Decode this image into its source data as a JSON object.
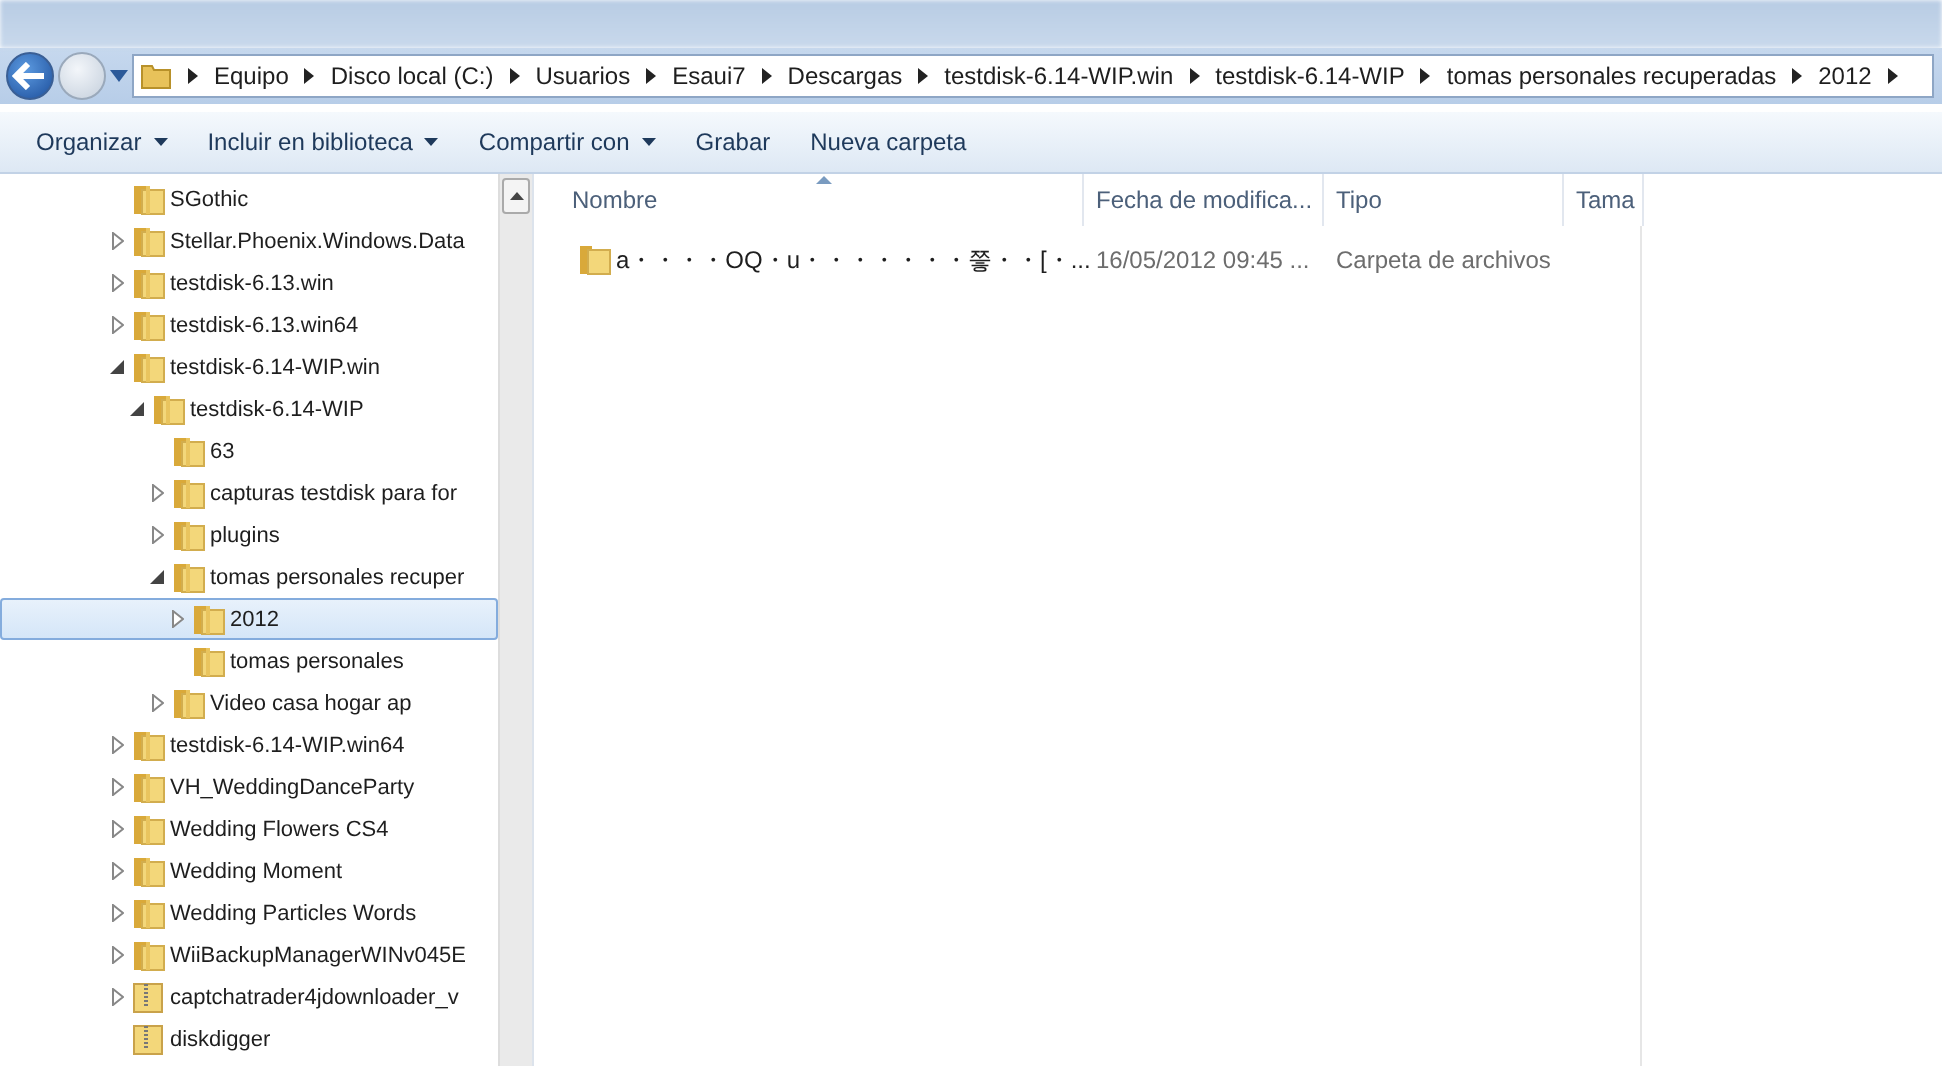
{
  "breadcrumb": [
    "Equipo",
    "Disco local (C:)",
    "Usuarios",
    "Esaui7",
    "Descargas",
    "testdisk-6.14-WIP.win",
    "testdisk-6.14-WIP",
    "tomas personales recuperadas",
    "2012"
  ],
  "toolbar": [
    {
      "label": "Organizar",
      "dropdown": true
    },
    {
      "label": "Incluir en biblioteca",
      "dropdown": true
    },
    {
      "label": "Compartir con",
      "dropdown": true
    },
    {
      "label": "Grabar",
      "dropdown": false
    },
    {
      "label": "Nueva carpeta",
      "dropdown": false
    }
  ],
  "tree": [
    {
      "label": "SGothic",
      "kind": "folder",
      "expandable": false,
      "selected": false
    },
    {
      "label": "Stellar.Phoenix.Windows.Data",
      "kind": "folder",
      "expandable": true,
      "expanded": false,
      "selected": false
    },
    {
      "label": "testdisk-6.13.win",
      "kind": "folder",
      "expandable": true,
      "expanded": false,
      "selected": false
    },
    {
      "label": "testdisk-6.13.win64",
      "kind": "folder",
      "expandable": true,
      "expanded": false,
      "selected": false
    },
    {
      "label": "testdisk-6.14-WIP.win",
      "kind": "folder",
      "expandable": true,
      "expanded": true,
      "selected": false,
      "children": [
        {
          "label": "testdisk-6.14-WIP",
          "kind": "folder",
          "expandable": true,
          "expanded": true,
          "selected": false,
          "children": [
            {
              "label": "63",
              "kind": "folder",
              "expandable": false,
              "selected": false
            },
            {
              "label": "capturas testdisk para for",
              "kind": "folder",
              "expandable": true,
              "expanded": false,
              "selected": false
            },
            {
              "label": "plugins",
              "kind": "folder",
              "expandable": true,
              "expanded": false,
              "selected": false
            },
            {
              "label": "tomas personales recuper",
              "kind": "folder",
              "expandable": true,
              "expanded": true,
              "selected": false,
              "children": [
                {
                  "label": "2012",
                  "kind": "folder",
                  "expandable": true,
                  "expanded": false,
                  "selected": true
                },
                {
                  "label": "tomas personales",
                  "kind": "folder",
                  "expandable": false,
                  "selected": false
                }
              ]
            },
            {
              "label": "Video casa hogar ap",
              "kind": "folder",
              "expandable": true,
              "expanded": false,
              "selected": false
            }
          ]
        }
      ]
    },
    {
      "label": "testdisk-6.14-WIP.win64",
      "kind": "folder",
      "expandable": true,
      "expanded": false,
      "selected": false
    },
    {
      "label": "VH_WeddingDanceParty",
      "kind": "folder",
      "expandable": true,
      "expanded": false,
      "selected": false
    },
    {
      "label": "Wedding Flowers CS4",
      "kind": "folder",
      "expandable": true,
      "expanded": false,
      "selected": false
    },
    {
      "label": "Wedding Moment",
      "kind": "folder",
      "expandable": true,
      "expanded": false,
      "selected": false
    },
    {
      "label": "Wedding Particles Words",
      "kind": "folder",
      "expandable": true,
      "expanded": false,
      "selected": false
    },
    {
      "label": "WiiBackupManagerWINv045E",
      "kind": "folder",
      "expandable": true,
      "expanded": false,
      "selected": false
    },
    {
      "label": "captchatrader4jdownloader_v",
      "kind": "zip",
      "expandable": true,
      "expanded": false,
      "selected": false
    },
    {
      "label": "diskdigger",
      "kind": "zip",
      "expandable": false,
      "selected": false
    }
  ],
  "table": {
    "columns": [
      "Nombre",
      "Fecha de modifica...",
      "Tipo",
      "Tama"
    ],
    "rows": [
      {
        "cells": [
          "a・・・・OQ・u・・・・・・・쯯・・[・...",
          "16/05/2012 09:45 ...",
          "Carpeta de archivos"
        ]
      }
    ]
  }
}
